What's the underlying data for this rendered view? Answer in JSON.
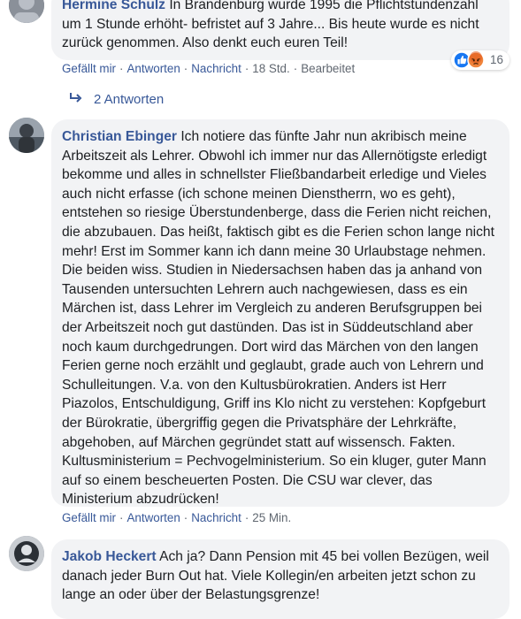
{
  "comments": [
    {
      "author": "Hermine Schulz",
      "text": "In Brandenburg wurde 1995 die Pflichtstundenzahl um 1 Stunde erhöht- befristet auf 3 Jahre... Bis heute wurde es nicht zurück genommen. Also denkt euch euren Teil!",
      "actions": {
        "like": "Gefällt mir",
        "reply": "Antworten",
        "message": "Nachricht",
        "time": "18 Std.",
        "edit": "Bearbeitet"
      },
      "reaction_count": "16",
      "replies_label": "2 Antworten"
    },
    {
      "author": "Christian Ebinger",
      "text": "Ich notiere das fünfte Jahr nun akribisch meine Arbeitszeit als Lehrer. Obwohl ich immer nur das Allernötigste erledigt bekomme und alles in schnellster Fließbandarbeit erledige und Vieles auch nicht erfasse (ich schone meinen Dienstherrn, wo es geht), entstehen so riesige Überstundenberge, dass die Ferien nicht reichen, die abzubauen. Das heißt, faktisch gibt es die Ferien schon lange nicht mehr! Erst im Sommer kann ich dann meine 30 Urlaubstage nehmen. Die beiden wiss. Studien in Niedersachsen haben das ja anhand von Tausenden untersuchten Lehrern auch nachgewiesen, dass es ein Märchen ist, dass Lehrer im Vergleich zu anderen Berufsgruppen bei der Arbeitszeit noch gut dastünden. Das ist in Süddeutschland aber noch kaum durchgedrungen. Dort wird das Märchen von den langen Ferien gerne noch erzählt und geglaubt, grade auch von Lehrern und Schulleitungen. V.a. von den Kultusbürokratien. Anders ist Herr Piazolos, Entschuldigung, Griff ins Klo nicht zu verstehen: Kopfgeburt der Bürokratie, übergriffig gegen die Privatsphäre der Lehrkräfte, abgehoben, auf Märchen gegründet statt auf wissensch. Fakten. Kultusministerium = Pechvogelministerium. So ein kluger, guter Mann auf so einem bescheuerten Posten. Die CSU war clever, das Ministerium abzudrücken!",
      "actions": {
        "like": "Gefällt mir",
        "reply": "Antworten",
        "message": "Nachricht",
        "time": "25 Min."
      }
    },
    {
      "author": "Jakob Heckert",
      "text": "Ach ja? Dann Pension mit 45 bei vollen Bezügen, weil danach jeder Burn Out hat. Viele Kollegin/en arbeiten jetzt schon zu lange an oder über der Belastungsgrenze!"
    }
  ],
  "colors": {
    "link": "#385898",
    "bubble": "#f2f3f5",
    "meta": "#606770",
    "like": "#1877f2",
    "angry": "#e9710f"
  },
  "icons": [
    "reply-arrow-icon",
    "like-reaction-icon",
    "angry-reaction-icon",
    "avatar-icon"
  ]
}
